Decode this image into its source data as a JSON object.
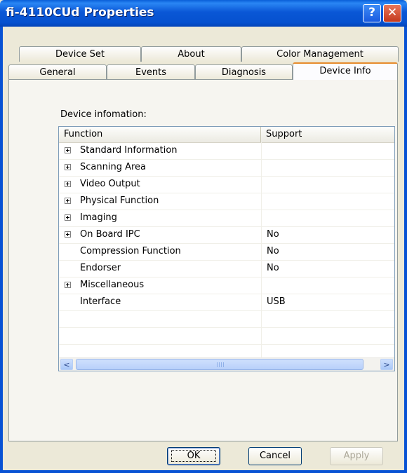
{
  "window": {
    "title": "fi-4110CUd Properties",
    "help_label": "?",
    "close_label": "✕"
  },
  "tabs_back": [
    "Device Set",
    "About",
    "Color Management"
  ],
  "tabs_front": [
    "General",
    "Events",
    "Diagnosis",
    "Device Info"
  ],
  "active_tab": "Device Info",
  "panel": {
    "section_label": "Device infomation:",
    "columns": [
      "Function",
      "Support"
    ],
    "rows": [
      {
        "label": "Standard Information",
        "expandable": true,
        "support": ""
      },
      {
        "label": "Scanning Area",
        "expandable": true,
        "support": ""
      },
      {
        "label": "Video Output",
        "expandable": true,
        "support": ""
      },
      {
        "label": "Physical Function",
        "expandable": true,
        "support": ""
      },
      {
        "label": "Imaging",
        "expandable": true,
        "support": ""
      },
      {
        "label": "On Board IPC",
        "expandable": true,
        "support": "No"
      },
      {
        "label": "Compression Function",
        "expandable": false,
        "support": "No"
      },
      {
        "label": "Endorser",
        "expandable": false,
        "support": "No"
      },
      {
        "label": "Miscellaneous",
        "expandable": true,
        "support": ""
      },
      {
        "label": "Interface",
        "expandable": false,
        "support": "USB"
      }
    ],
    "scroll_left": "<",
    "scroll_right": ">"
  },
  "buttons": {
    "ok": "OK",
    "cancel": "Cancel",
    "apply": "Apply"
  },
  "colors": {
    "titlebar": "#0a57d6",
    "active_tab_accent": "#e68b2c",
    "dialog_bg": "#ece9d8"
  }
}
